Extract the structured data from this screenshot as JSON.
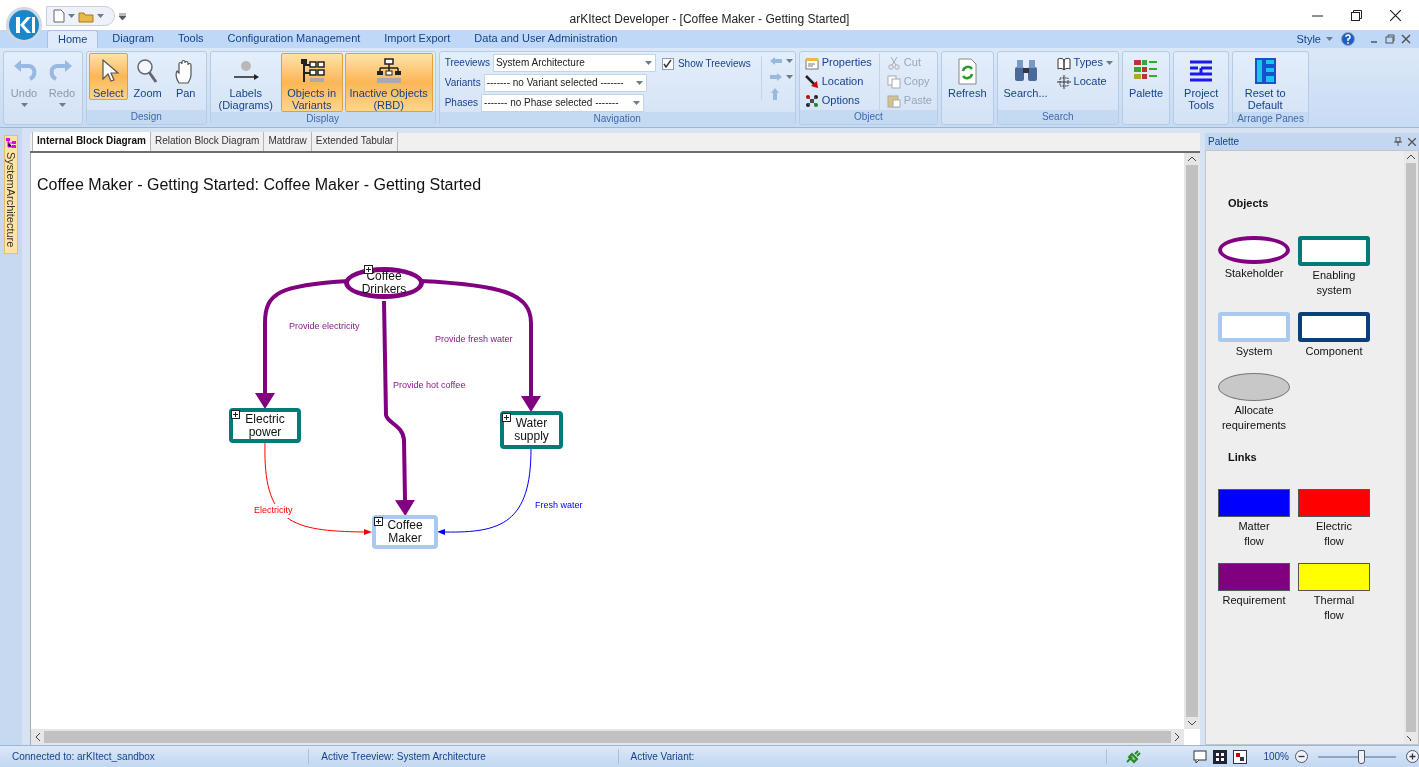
{
  "window": {
    "title": "arKItect Developer - [Coffee Maker - Getting Started]"
  },
  "ribbon_tabs": [
    {
      "label": "Home",
      "selected": true
    },
    {
      "label": "Diagram",
      "selected": false
    },
    {
      "label": "Tools",
      "selected": false
    },
    {
      "label": "Configuration Management",
      "selected": false
    },
    {
      "label": "Import Export",
      "selected": false
    },
    {
      "label": "Data and User Administration",
      "selected": false
    }
  ],
  "style_menu": {
    "label": "Style"
  },
  "ribbon_groups": [
    {
      "kind": "buttons",
      "buttons": [
        {
          "label": "Undo",
          "kind": "large",
          "selected": false,
          "disabled": true,
          "dropdown": true
        },
        {
          "label": "Redo",
          "kind": "large",
          "selected": false,
          "disabled": true,
          "dropdown": true
        }
      ]
    },
    {
      "kind": "buttons",
      "label": "Design",
      "buttons": [
        {
          "label": "Select",
          "kind": "large",
          "selected": true,
          "disabled": false,
          "dropdown": false
        },
        {
          "label": "Zoom",
          "kind": "large",
          "selected": false,
          "disabled": false,
          "dropdown": false
        },
        {
          "label": "Pan",
          "kind": "large",
          "selected": false,
          "disabled": false,
          "dropdown": false
        }
      ]
    },
    {
      "kind": "buttons",
      "label": "Display",
      "buttons": [
        {
          "label": "Labels (Diagrams)",
          "kind": "large",
          "selected": false,
          "disabled": false,
          "dropdown": false
        },
        {
          "label": "Objects in Variants",
          "kind": "large",
          "selected": true,
          "disabled": false,
          "dropdown": false
        },
        {
          "label": "Inactive Objects (RBD)",
          "kind": "large",
          "selected": true,
          "disabled": false,
          "dropdown": false
        }
      ]
    },
    {
      "kind": "navigation",
      "label": "Navigation",
      "fields": [
        {
          "label": "Treeviews",
          "value": "System Architecture"
        },
        {
          "label": "Variants",
          "value": "------- no Variant selected -------"
        },
        {
          "label": "Phases",
          "value": "------- no Phase selected -------"
        }
      ],
      "checkbox": {
        "label": "Show Treeviews",
        "checked": true
      }
    },
    {
      "kind": "buttons",
      "label": "Object",
      "buttons": [
        {
          "label": "Properties",
          "kind": "small",
          "selected": false,
          "disabled": false,
          "dropdown": false
        },
        {
          "label": "Location",
          "kind": "small",
          "selected": false,
          "disabled": false,
          "dropdown": false
        },
        {
          "label": "Options",
          "kind": "small",
          "selected": false,
          "disabled": false,
          "dropdown": false
        },
        {
          "label": "Cut",
          "kind": "small",
          "selected": false,
          "disabled": true,
          "dropdown": false
        },
        {
          "label": "Copy",
          "kind": "small",
          "selected": false,
          "disabled": true,
          "dropdown": false
        },
        {
          "label": "Paste",
          "kind": "small",
          "selected": false,
          "disabled": true,
          "dropdown": false
        }
      ]
    },
    {
      "kind": "buttons",
      "buttons": [
        {
          "label": "Refresh",
          "kind": "large",
          "selected": false,
          "disabled": false,
          "dropdown": false
        }
      ]
    },
    {
      "kind": "buttons",
      "label": "Search",
      "buttons": [
        {
          "label": "Search...",
          "kind": "large",
          "selected": false,
          "disabled": false,
          "dropdown": false
        },
        {
          "label": "Types",
          "kind": "small",
          "selected": false,
          "disabled": false,
          "dropdown": true
        },
        {
          "label": "Locate",
          "kind": "small",
          "selected": false,
          "disabled": false,
          "dropdown": false
        }
      ]
    },
    {
      "kind": "buttons",
      "buttons": [
        {
          "label": "Palette",
          "kind": "large",
          "selected": false,
          "disabled": false,
          "dropdown": false
        }
      ]
    },
    {
      "kind": "buttons",
      "buttons": [
        {
          "label": "Project Tools",
          "kind": "large",
          "selected": false,
          "disabled": false,
          "dropdown": false
        }
      ]
    },
    {
      "kind": "buttons",
      "label": "Arrange Panes",
      "buttons": [
        {
          "label": "Reset to Default",
          "kind": "large",
          "selected": false,
          "disabled": false,
          "dropdown": false
        }
      ]
    }
  ],
  "side_tab": {
    "label": "SystemArchitecture"
  },
  "document_tabs": [
    {
      "label": "Internal Block Diagram",
      "selected": true
    },
    {
      "label": "Relation Block Diagram",
      "selected": false
    },
    {
      "label": "Matdraw",
      "selected": false
    },
    {
      "label": "Extended Tabular",
      "selected": false
    }
  ],
  "diagram": {
    "title": "Coffee Maker - Getting Started: Coffee Maker - Getting Started",
    "nodes": [
      {
        "label": "Coffee Drinkers",
        "kind": "stakeholder"
      },
      {
        "label": "Electric power",
        "kind": "enabling"
      },
      {
        "label": "Water supply",
        "kind": "enabling"
      },
      {
        "label": "Coffee Maker",
        "kind": "system"
      }
    ],
    "links": [
      {
        "label": "Provide electricity",
        "kind": "requirement"
      },
      {
        "label": "Provide fresh water",
        "kind": "requirement"
      },
      {
        "label": "Provide hot coffee",
        "kind": "requirement"
      },
      {
        "label": "Electricity",
        "kind": "electric"
      },
      {
        "label": "Fresh water",
        "kind": "matter"
      }
    ]
  },
  "palette": {
    "title": "Palette",
    "sections": [
      {
        "heading": "Objects",
        "items": [
          {
            "label": "Stakeholder",
            "kind": "ring",
            "color": "#800080"
          },
          {
            "label": "Enabling system",
            "kind": "frame",
            "color": "#007b78"
          },
          {
            "label": "System",
            "kind": "frame",
            "color": "#a9caee"
          },
          {
            "label": "Component",
            "kind": "frame",
            "color": "#0a3f7c"
          },
          {
            "label": "Allocate requirements",
            "kind": "disc",
            "color": "#c8c8c8"
          }
        ]
      },
      {
        "heading": "Links",
        "items": [
          {
            "label": "Matter flow",
            "kind": "bar",
            "color": "#0000ff"
          },
          {
            "label": "Electric flow",
            "kind": "bar",
            "color": "#ff0000"
          },
          {
            "label": "Requirement",
            "kind": "bar",
            "color": "#800080"
          },
          {
            "label": "Thermal flow",
            "kind": "bar",
            "color": "#ffff00"
          }
        ]
      }
    ]
  },
  "status_bar": {
    "connection": "Connected to: arKItect_sandbox",
    "treeview": "Active Treeview: System Architecture",
    "variant": "Active Variant:",
    "zoom": {
      "reading": "100%",
      "level": 0.55
    }
  }
}
